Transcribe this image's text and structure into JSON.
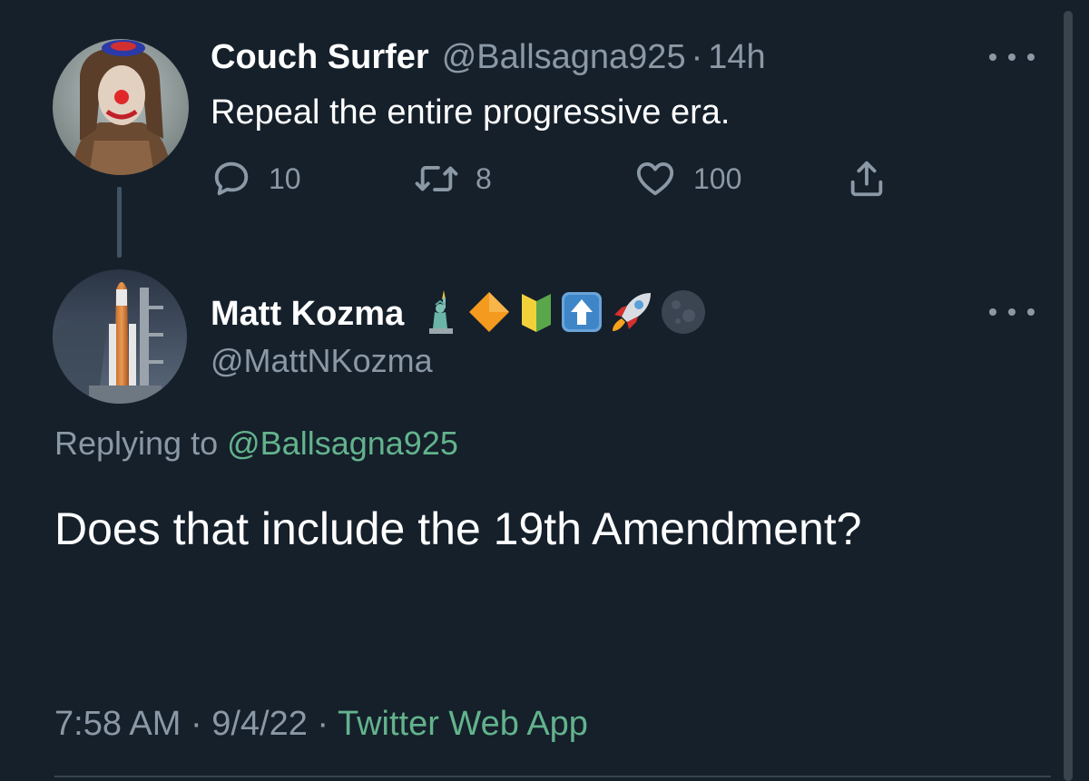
{
  "parent_tweet": {
    "display_name": "Couch Surfer",
    "handle": "@Ballsagna925",
    "separator": "·",
    "time_ago": "14h",
    "text": "Repeal the entire progressive era.",
    "reply_count": "10",
    "retweet_count": "8",
    "like_count": "100",
    "icons": [
      "more-icon",
      "reply-icon",
      "retweet-icon",
      "like-icon",
      "share-icon"
    ]
  },
  "reply_tweet": {
    "display_name": "Matt Kozma",
    "name_emojis": [
      "statue-of-liberty",
      "orange-diamond",
      "beginner-badge",
      "up-arrow",
      "rocket",
      "new-moon"
    ],
    "handle": "@MattNKozma",
    "replying_prefix": "Replying to",
    "replying_to": "@Ballsagna925",
    "text": "Does that include the 19th Amendment?",
    "time": "7:58 AM",
    "date": "9/4/22",
    "separator": "·",
    "source": "Twitter Web App"
  },
  "colors": {
    "background": "#15202b",
    "secondary_text": "#8b98a5",
    "link_green": "#63b38c"
  }
}
